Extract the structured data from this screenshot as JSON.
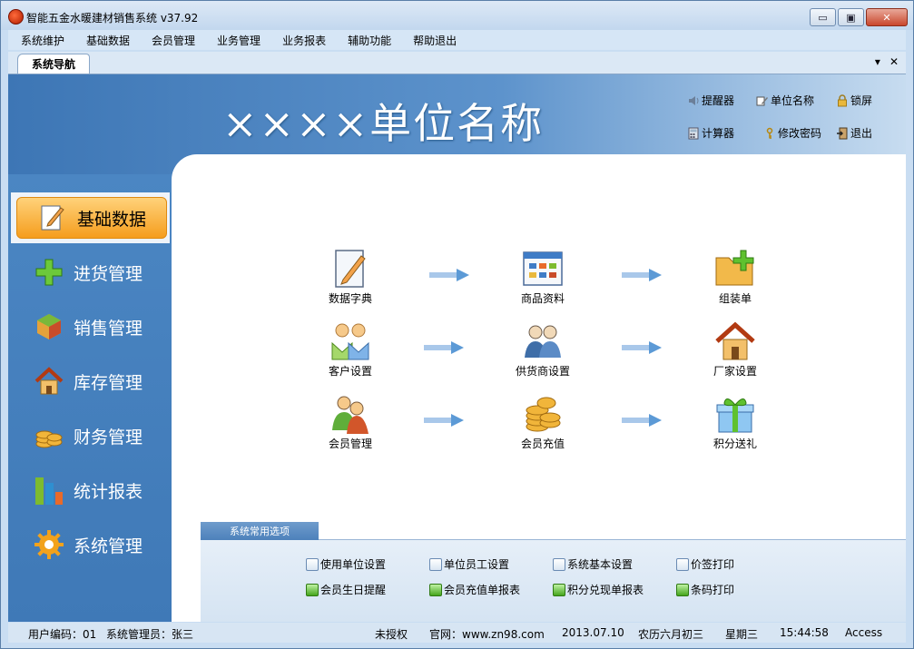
{
  "window": {
    "title": "智能五金水暖建材销售系统 v37.92",
    "controls": {
      "minimize": "▭",
      "maximize": "▣",
      "close": "✕"
    }
  },
  "menu": [
    "系统维护",
    "基础数据",
    "会员管理",
    "业务管理",
    "业务报表",
    "辅助功能",
    "帮助退出"
  ],
  "tabs": {
    "active": "系统导航",
    "dropdown": "▾",
    "close": "✕"
  },
  "header": {
    "unit_name": "××××单位名称",
    "tools": [
      {
        "label": "提醒器",
        "icon": "speaker-icon"
      },
      {
        "label": "单位名称",
        "icon": "edit-icon"
      },
      {
        "label": "锁屏",
        "icon": "lock-icon"
      },
      {
        "label": "计算器",
        "icon": "calculator-icon"
      },
      {
        "label": "修改密码",
        "icon": "key-icon"
      },
      {
        "label": "退出",
        "icon": "exit-door-icon"
      }
    ]
  },
  "sidebar": {
    "items": [
      {
        "label": "基础数据",
        "icon": "pencil-document-icon",
        "active": true
      },
      {
        "label": "进货管理",
        "icon": "green-plus-icon"
      },
      {
        "label": "销售管理",
        "icon": "cube-icon"
      },
      {
        "label": "库存管理",
        "icon": "house-icon"
      },
      {
        "label": "财务管理",
        "icon": "coins-icon"
      },
      {
        "label": "统计报表",
        "icon": "bar-chart-icon"
      },
      {
        "label": "系统管理",
        "icon": "gear-icon"
      }
    ]
  },
  "flow": [
    {
      "label": "数据字典",
      "icon": "pencil-document-icon"
    },
    {
      "label": "商品资料",
      "icon": "window-grid-icon"
    },
    {
      "label": "组装单",
      "icon": "folder-plus-icon"
    },
    {
      "label": "客户设置",
      "icon": "customers-icon"
    },
    {
      "label": "供货商设置",
      "icon": "suppliers-icon"
    },
    {
      "label": "厂家设置",
      "icon": "house-icon"
    },
    {
      "label": "会员管理",
      "icon": "members-icon"
    },
    {
      "label": "会员充值",
      "icon": "coins-icon"
    },
    {
      "label": "积分送礼",
      "icon": "gift-icon"
    }
  ],
  "options": {
    "title": "系统常用选项",
    "items": [
      {
        "label": "使用单位设置",
        "icon": "settings-icon"
      },
      {
        "label": "单位员工设置",
        "icon": "settings-icon"
      },
      {
        "label": "系统基本设置",
        "icon": "settings-icon"
      },
      {
        "label": "价签打印",
        "icon": "settings-icon"
      },
      {
        "label": "会员生日提醒",
        "icon": "report-icon"
      },
      {
        "label": "会员充值单报表",
        "icon": "report-icon"
      },
      {
        "label": "积分兑现单报表",
        "icon": "report-icon"
      },
      {
        "label": "条码打印",
        "icon": "report-icon"
      }
    ]
  },
  "status": {
    "user_code": "用户编码：01",
    "operator": "系统管理员：张三",
    "license": "未授权",
    "website": "官网：www.zn98.com",
    "date": "2013.07.10",
    "lunar": "农历六月初三",
    "weekday": "星期三",
    "time": "15:44:58",
    "db": "Access"
  },
  "colors": {
    "accent": "#3f79b7",
    "active_nav": "#f59d1d",
    "panel": "#ffffff"
  }
}
